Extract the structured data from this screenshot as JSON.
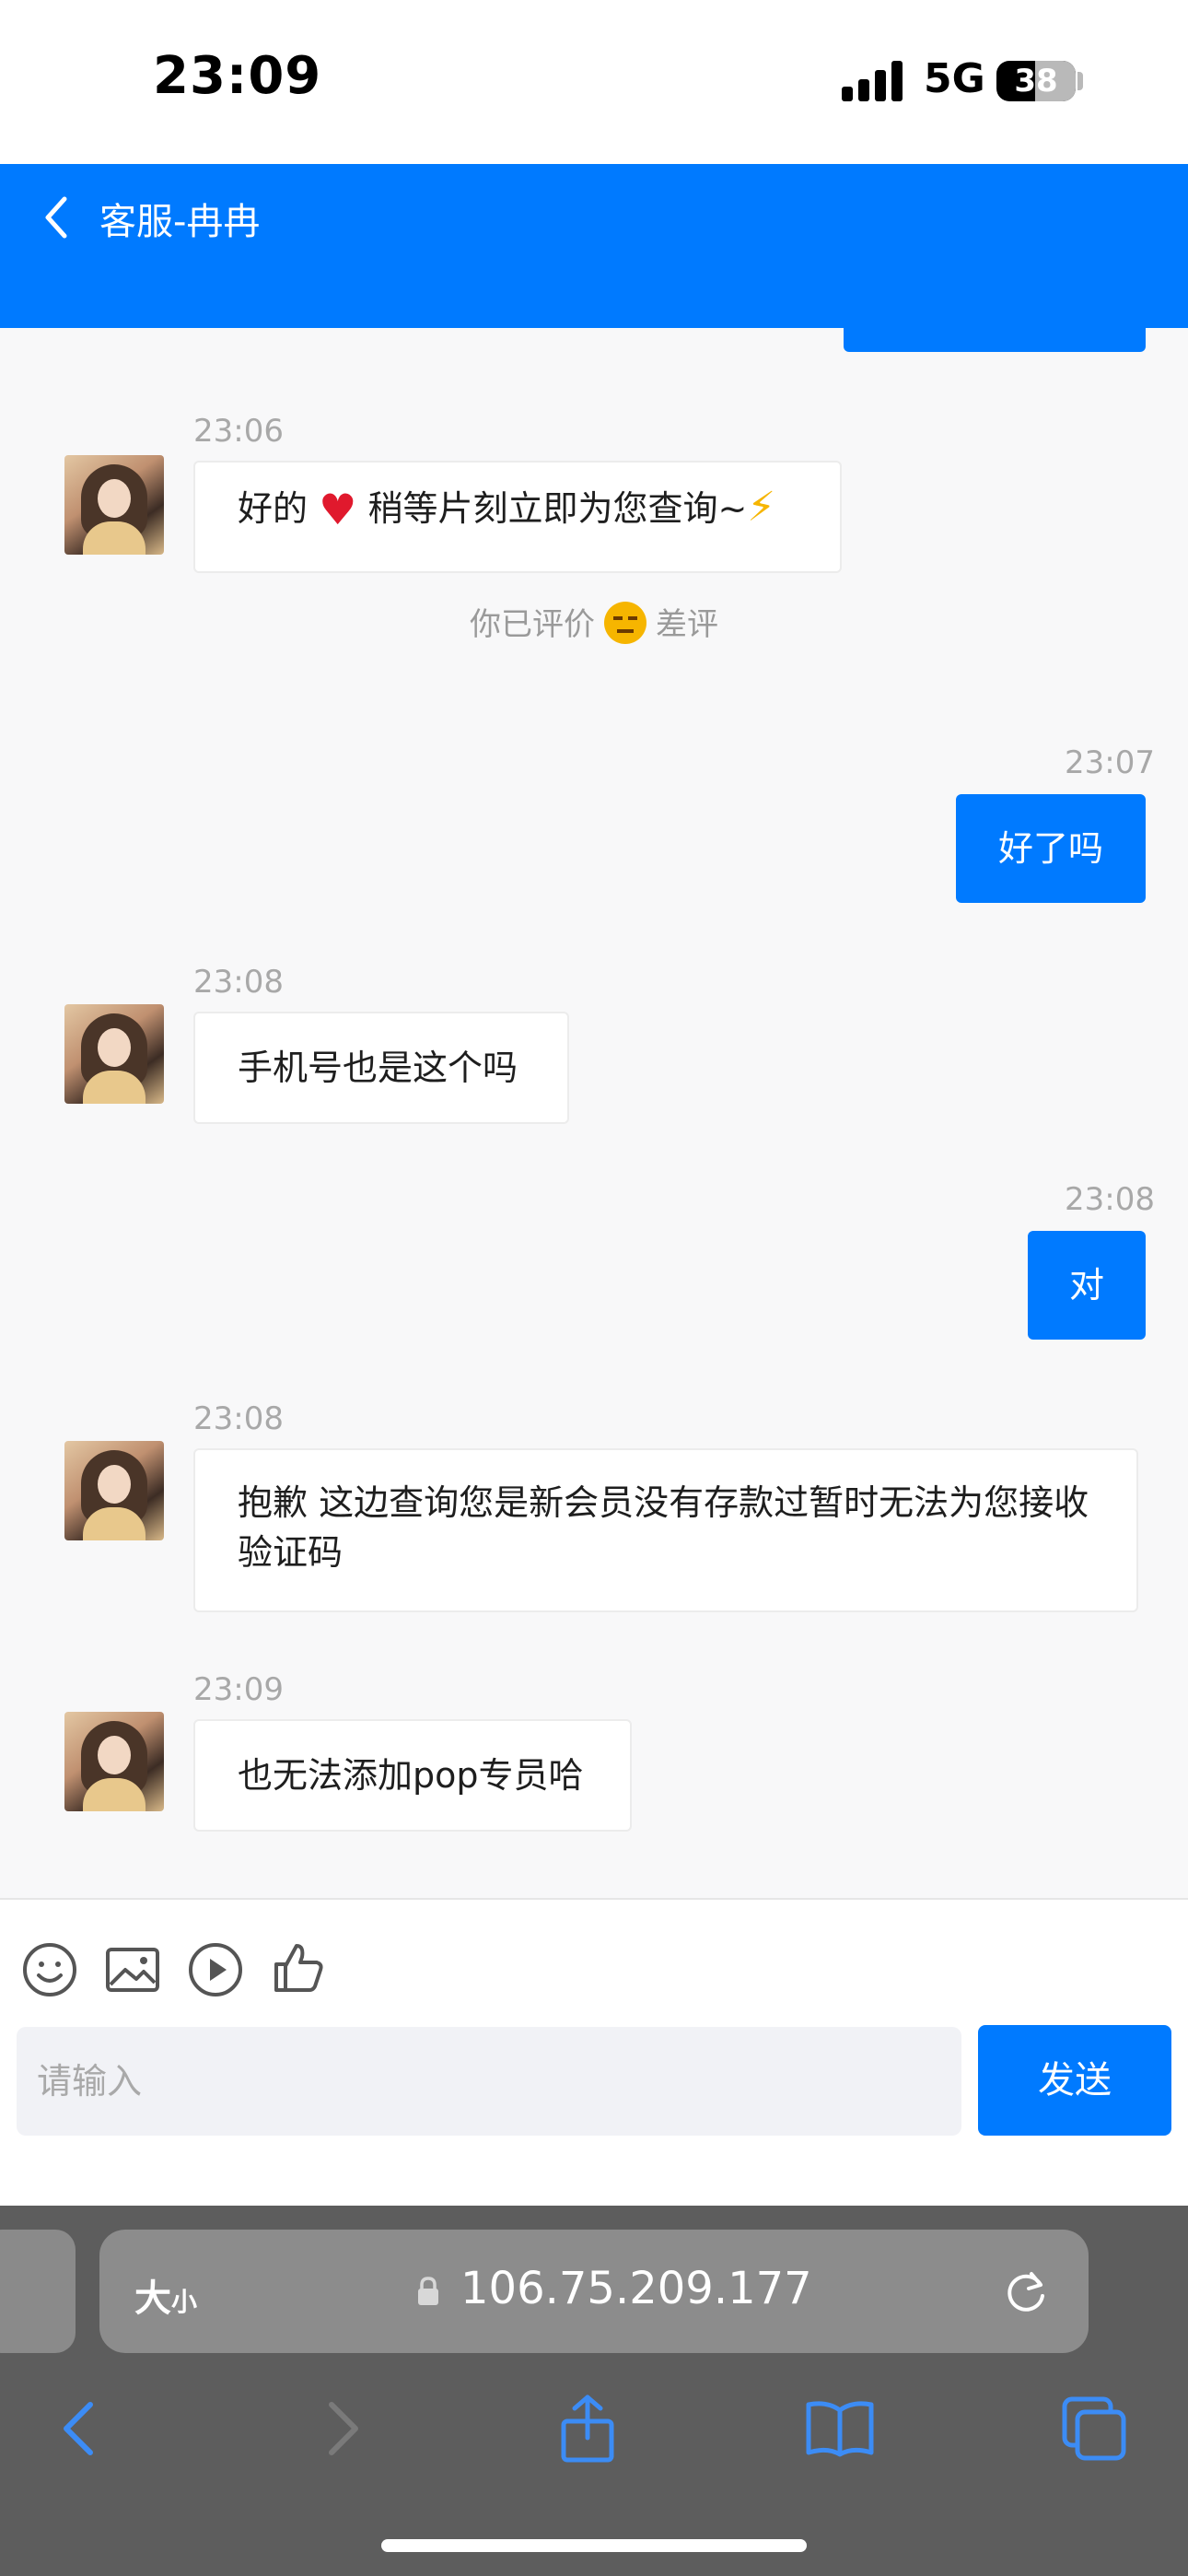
{
  "status_bar": {
    "time": "23:09",
    "network": "5G",
    "battery": "38"
  },
  "header": {
    "title": "客服-冉冉"
  },
  "messages": [
    {
      "side": "in",
      "time": "23:06",
      "text_before": "好的",
      "text_after": "稍等片刻立即为您查询~"
    },
    {
      "side": "system",
      "rating_prefix": "你已评价",
      "rating_value": "差评"
    },
    {
      "side": "out",
      "time": "23:07",
      "text": "好了吗"
    },
    {
      "side": "in",
      "time": "23:08",
      "text": "手机号也是这个吗"
    },
    {
      "side": "out",
      "time": "23:08",
      "text": "对"
    },
    {
      "side": "in",
      "time": "23:08",
      "text": "抱歉 这边查询您是新会员没有存款过暂时无法为您接收验证码"
    },
    {
      "side": "in",
      "time": "23:09",
      "text": "也无法添加pop专员哈"
    }
  ],
  "composer": {
    "tools": [
      "smile-icon",
      "image-icon",
      "video-icon",
      "thumbs-up-icon"
    ],
    "placeholder": "请输入",
    "send_label": "发送"
  },
  "browser": {
    "text_size_big": "大",
    "text_size_small": "小",
    "url": "106.75.209.177",
    "toolbar": [
      "back-icon",
      "forward-icon",
      "share-icon",
      "bookmarks-icon",
      "tabs-icon"
    ]
  },
  "colors": {
    "accent": "#007aff",
    "background": "#f8f8f9",
    "browser_bar": "#5d5d5d"
  }
}
